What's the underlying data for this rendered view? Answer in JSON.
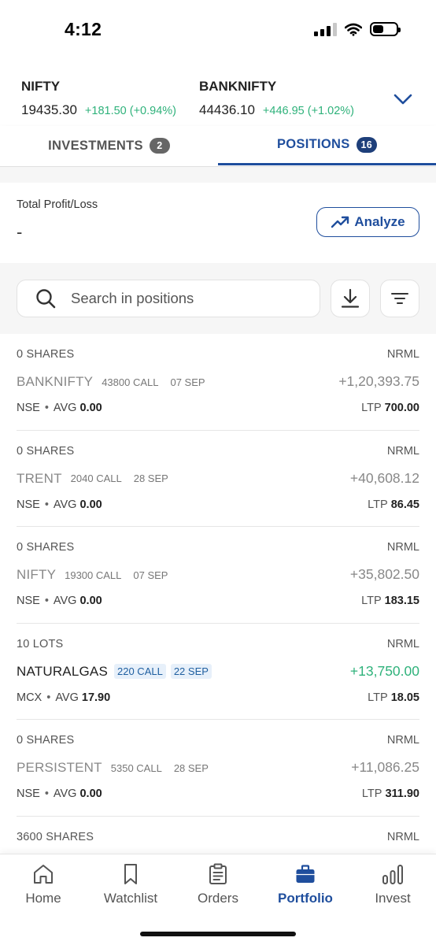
{
  "status_bar": {
    "time": "4:12"
  },
  "indices": [
    {
      "name": "NIFTY",
      "price": "19435.30",
      "change": "+181.50 (+0.94%)"
    },
    {
      "name": "BANKNIFTY",
      "price": "44436.10",
      "change": "+446.95 (+1.02%)"
    }
  ],
  "tabs": [
    {
      "label": "INVESTMENTS",
      "count": "2"
    },
    {
      "label": "POSITIONS",
      "count": "16"
    }
  ],
  "profit": {
    "label": "Total Profit/Loss",
    "value": "-",
    "analyze_label": "Analyze"
  },
  "search": {
    "placeholder": "Search in positions"
  },
  "positions": [
    {
      "qty": "0 SHARES",
      "product": "NRML",
      "symbol": "BANKNIFTY",
      "strike": "43800 CALL",
      "expiry": "07 SEP",
      "pnl": "+1,20,393.75",
      "exchange": "NSE",
      "avg_label": "AVG",
      "avg": "0.00",
      "ltp_label": "LTP",
      "ltp": "700.00"
    },
    {
      "qty": "0 SHARES",
      "product": "NRML",
      "symbol": "TRENT",
      "strike": "2040 CALL",
      "expiry": "28 SEP",
      "pnl": "+40,608.12",
      "exchange": "NSE",
      "avg_label": "AVG",
      "avg": "0.00",
      "ltp_label": "LTP",
      "ltp": "86.45"
    },
    {
      "qty": "0 SHARES",
      "product": "NRML",
      "symbol": "NIFTY",
      "strike": "19300 CALL",
      "expiry": "07 SEP",
      "pnl": "+35,802.50",
      "exchange": "NSE",
      "avg_label": "AVG",
      "avg": "0.00",
      "ltp_label": "LTP",
      "ltp": "183.15"
    },
    {
      "qty": "10 LOTS",
      "product": "NRML",
      "symbol": "NATURALGAS",
      "strike": "220 CALL",
      "expiry": "22 SEP",
      "pnl": "+13,750.00",
      "exchange": "MCX",
      "avg_label": "AVG",
      "avg": "17.90",
      "ltp_label": "LTP",
      "ltp": "18.05"
    },
    {
      "qty": "0 SHARES",
      "product": "NRML",
      "symbol": "PERSISTENT",
      "strike": "5350 CALL",
      "expiry": "28 SEP",
      "pnl": "+11,086.25",
      "exchange": "NSE",
      "avg_label": "AVG",
      "avg": "0.00",
      "ltp_label": "LTP",
      "ltp": "311.90"
    },
    {
      "qty": "3600 SHARES",
      "product": "NRML"
    }
  ],
  "bottom_nav": [
    {
      "label": "Home",
      "icon": "home-icon"
    },
    {
      "label": "Watchlist",
      "icon": "bookmark-icon"
    },
    {
      "label": "Orders",
      "icon": "clipboard-icon"
    },
    {
      "label": "Portfolio",
      "icon": "briefcase-icon"
    },
    {
      "label": "Invest",
      "icon": "bar-chart-icon"
    }
  ],
  "colors": {
    "accent": "#1f4e9d",
    "positive": "#2fb27b",
    "badge_dark": "#1e3f7a"
  }
}
